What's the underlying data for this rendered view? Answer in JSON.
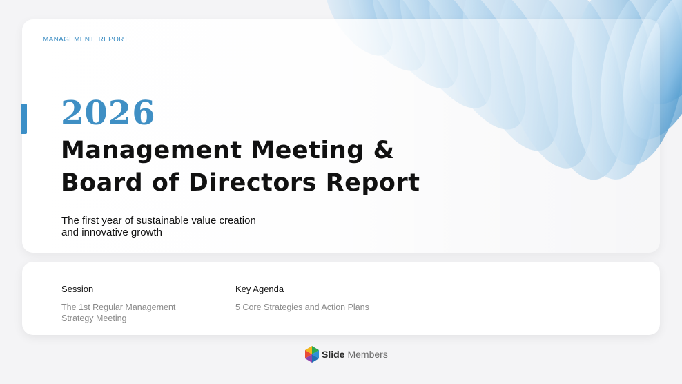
{
  "header": {
    "kicker": "MANAGEMENT  REPORT"
  },
  "hero": {
    "year": "2026",
    "title_line1": "Management Meeting &",
    "title_line2": "Board of Directors Report",
    "subtitle_line1": "The first year of sustainable value creation",
    "subtitle_line2": "and innovative growth"
  },
  "info": {
    "session_label": "Session",
    "session_value_line1": "The 1st Regular Management",
    "session_value_line2": "Strategy Meeting",
    "agenda_label": "Key Agenda",
    "agenda_value": "5 Core Strategies and Action Plans"
  },
  "brand": {
    "name_part1": "Slide",
    "name_part2": "Members"
  },
  "colors": {
    "accent": "#3f8fc4",
    "text_dark": "#111111",
    "text_muted": "#8a8a8a",
    "background": "#f4f4f6",
    "card": "#ffffff"
  },
  "icons": {
    "decorative_art": "blue-coil-graphic",
    "brand_logo": "slidemembers-logo"
  }
}
